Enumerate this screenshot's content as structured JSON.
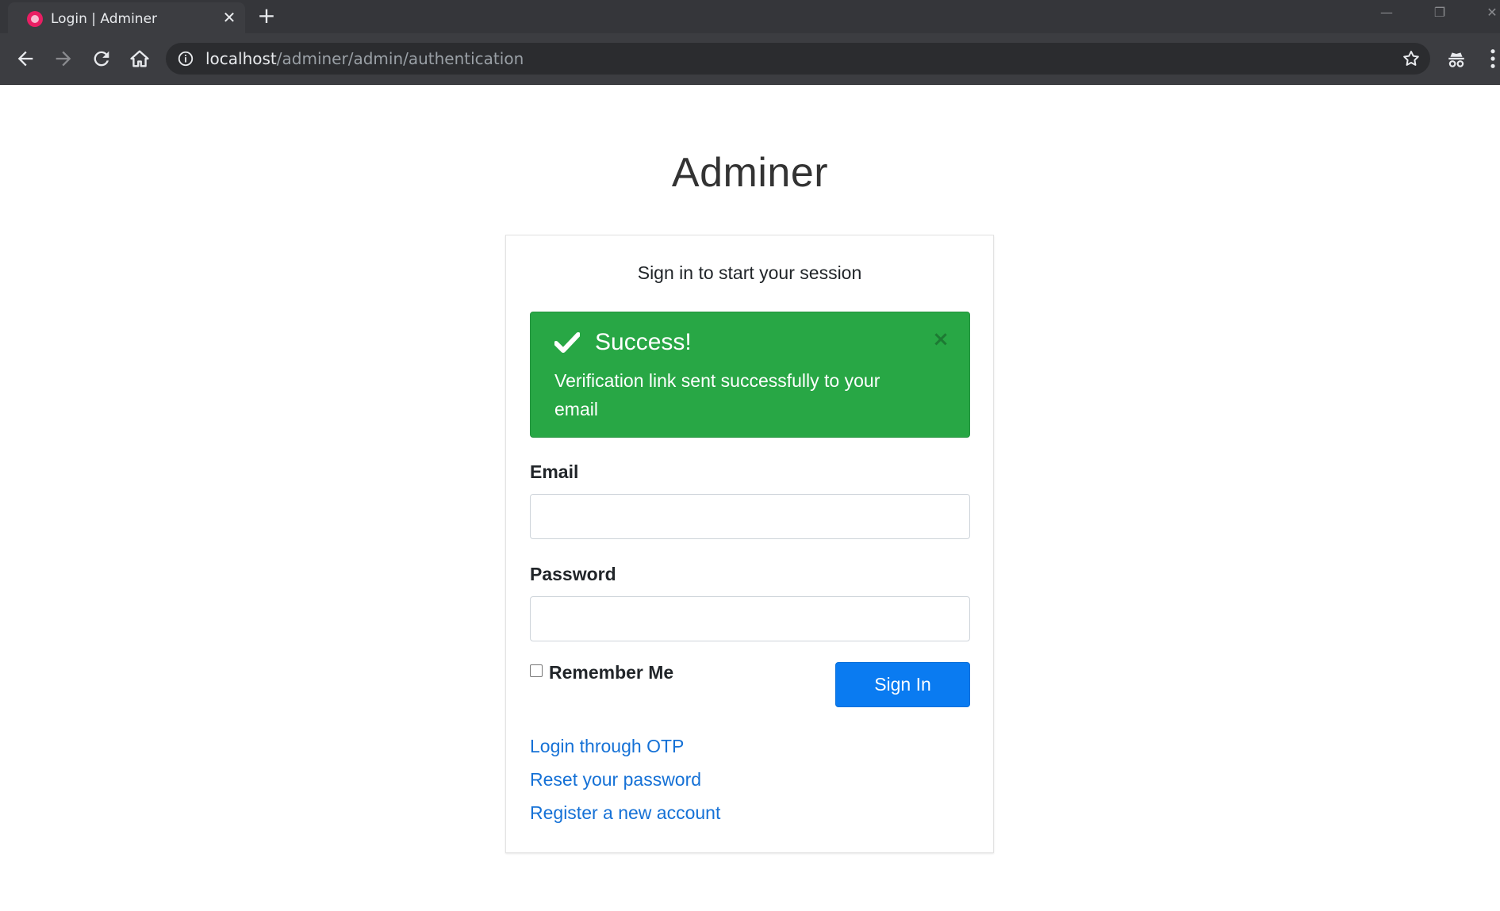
{
  "browser": {
    "tab_title": "Login | Adminer",
    "url_host": "localhost",
    "url_path": "/adminer/admin/authentication"
  },
  "page": {
    "brand": "Adminer",
    "login_box_msg": "Sign in to start your session",
    "alert": {
      "title": "Success!",
      "message": "Verification link sent successfully to your email",
      "color": "#28a745"
    },
    "email_label": "Email",
    "email_value": "",
    "password_label": "Password",
    "password_value": "",
    "remember_label": "Remember Me",
    "remember_checked": false,
    "signin_label": "Sign In",
    "primary_color": "#0a7bf1",
    "links": {
      "otp": "Login through OTP",
      "reset": "Reset your password",
      "register": "Register a new account"
    }
  }
}
